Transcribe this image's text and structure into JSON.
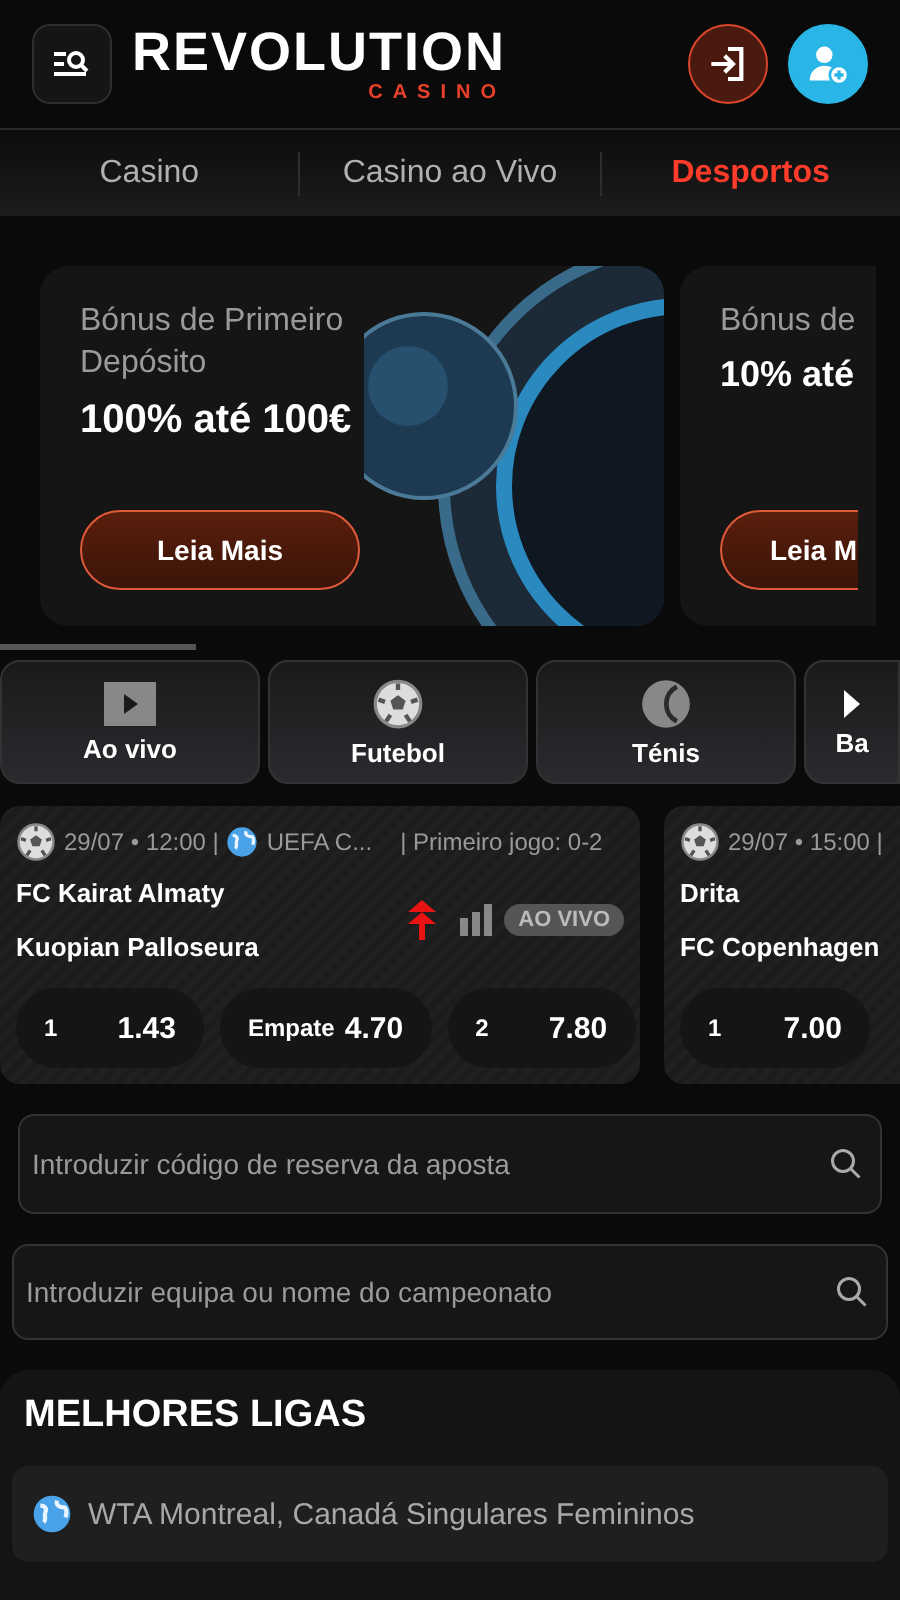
{
  "header": {
    "logo": "REVOLUTION",
    "logo_sub": "CASINO"
  },
  "nav_tabs": [
    {
      "label": "Casino",
      "selected": false
    },
    {
      "label": "Casino ao Vivo",
      "selected": false
    },
    {
      "label": "Desportos",
      "selected": true
    }
  ],
  "banners": [
    {
      "title": "Bónus de Primeiro Depósito",
      "offer": "100% até 100€",
      "button": "Leia Mais"
    },
    {
      "title": "Bónus de",
      "offer": "10% até",
      "button": "Leia M"
    }
  ],
  "sports": [
    {
      "label": "Ao vivo",
      "kind": "live"
    },
    {
      "label": "Futebol",
      "kind": "football"
    },
    {
      "label": "Ténis",
      "kind": "tennis"
    },
    {
      "label": "Ba",
      "kind": "more"
    }
  ],
  "matches": [
    {
      "datetime": "29/07 • 12:00 |",
      "league": "UEFA C...",
      "note": "| Primeiro jogo: 0-2",
      "home": "FC Kairat Almaty",
      "away": "Kuopian Palloseura",
      "badge": "AO VIVO",
      "odds": [
        {
          "label": "1",
          "value": "1.43"
        },
        {
          "label": "Empate",
          "value": "4.70"
        },
        {
          "label": "2",
          "value": "7.80"
        }
      ]
    },
    {
      "datetime": "29/07 • 15:00 |",
      "home": "Drita",
      "away": "FC Copenhagen",
      "odds": [
        {
          "label": "1",
          "value": "7.00"
        }
      ]
    }
  ],
  "booking_search": {
    "placeholder": "Introduzir código de reserva da aposta"
  },
  "team_search": {
    "placeholder": "Introduzir equipa ou nome do campeonato"
  },
  "top_leagues": {
    "title": "MELHORES LIGAS",
    "items": [
      {
        "name": "WTA Montreal, Canadá Singulares Femininos"
      }
    ]
  }
}
